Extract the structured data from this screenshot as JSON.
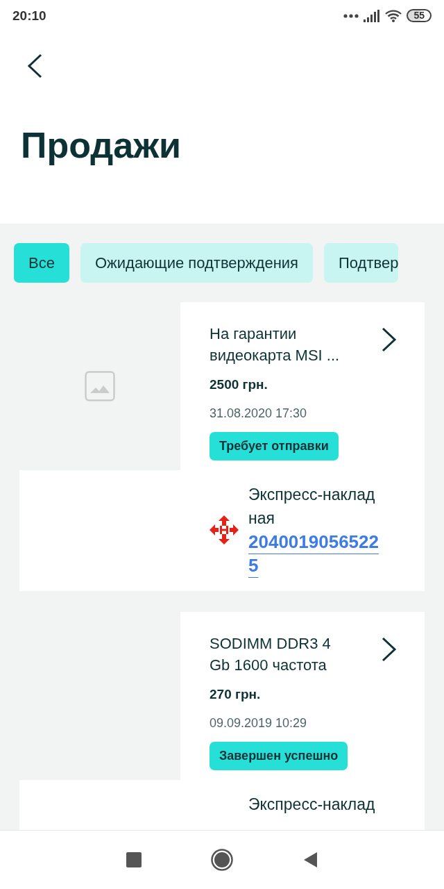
{
  "status_bar": {
    "time": "20:10",
    "battery": "55"
  },
  "header": {
    "title": "Продажи"
  },
  "filters": [
    {
      "label": "Все",
      "selected": true
    },
    {
      "label": "Ожидающие подтверждения",
      "selected": false
    },
    {
      "label": "Подтвер",
      "selected": false
    }
  ],
  "sales": [
    {
      "has_image": true,
      "title": "На гарантии видеокарта MSI ...",
      "price": "2500 грн.",
      "date": "31.08.2020 17:30",
      "status": "Требует отправки",
      "waybill_label": "Экспресс-накладная",
      "waybill_number": "20400190565225"
    },
    {
      "has_image": false,
      "title": "SODIMM DDR3 4 Gb 1600 частота",
      "price": "270 грн.",
      "date": "09.09.2019 10:29",
      "status": "Завершен успешно",
      "waybill_label": "Экспресс-наклад"
    }
  ]
}
